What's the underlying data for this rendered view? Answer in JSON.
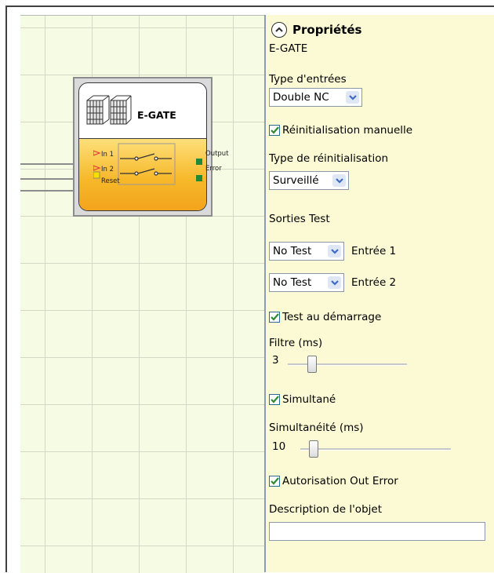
{
  "block": {
    "title": "E-GATE",
    "inputs": [
      "In 1",
      "In 2",
      "Reset"
    ],
    "outputs": [
      "Output",
      "Error"
    ]
  },
  "panel": {
    "title": "Propriétés",
    "subtitle": "E-GATE",
    "input_type_label": "Type d'entrées",
    "input_type_value": "Double NC",
    "manual_reset_label": "Réinitialisation manuelle",
    "manual_reset_checked": true,
    "reset_type_label": "Type de réinitialisation",
    "reset_type_value": "Surveillé",
    "test_outputs_label": "Sorties Test",
    "test_rows": [
      {
        "value": "No Test",
        "label": "Entrée 1"
      },
      {
        "value": "No Test",
        "label": "Entrée 2"
      }
    ],
    "startup_test_label": "Test au démarrage",
    "startup_test_checked": true,
    "filter_label": "Filtre (ms)",
    "filter_value": "3",
    "simultaneous_label": "Simultané",
    "simultaneous_checked": true,
    "simultaneity_label": "Simultanéité (ms)",
    "simultaneity_value": "10",
    "out_error_label": "Autorisation Out Error",
    "out_error_checked": true,
    "description_label": "Description de l'objet",
    "description_value": ""
  },
  "colors": {
    "panel_bg": "#fcfad4",
    "canvas_bg": "#f6fbe3",
    "block_gradient": "#f7b82a",
    "pin_input": "#e33b3b",
    "pin_output": "#1f8a3a",
    "checkbox_check": "#2e8b2e"
  }
}
